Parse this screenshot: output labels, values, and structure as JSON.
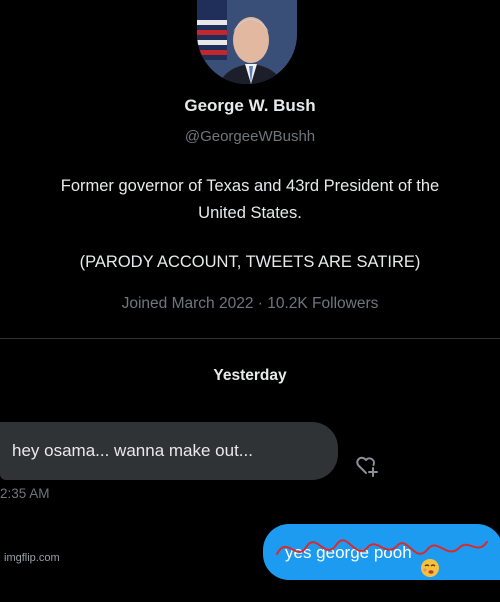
{
  "profile": {
    "name": "George W. Bush",
    "handle": "@GeorgeeWBushh",
    "bio_line1": "Former governor of Texas and 43rd President of the",
    "bio_line2": "United States.",
    "bio_line3": "(PARODY ACCOUNT, TWEETS ARE SATIRE)",
    "joined": "Joined March 2022",
    "separator": "·",
    "followers": "10.2K Followers"
  },
  "conversation": {
    "day_label": "Yesterday",
    "messages": [
      {
        "direction": "incoming",
        "text": "hey osama... wanna make out...",
        "time": "2:35 AM"
      },
      {
        "direction": "outgoing",
        "text": "yes george pooh"
      }
    ]
  },
  "icons": {
    "react": "heart-plus-icon",
    "emoji": "face-emoji-icon"
  },
  "watermark": "imgflip.com",
  "colors": {
    "background": "#000000",
    "incoming_bubble": "#2f3336",
    "outgoing_bubble": "#1d9bf0",
    "scribble": "#d92b2b"
  }
}
